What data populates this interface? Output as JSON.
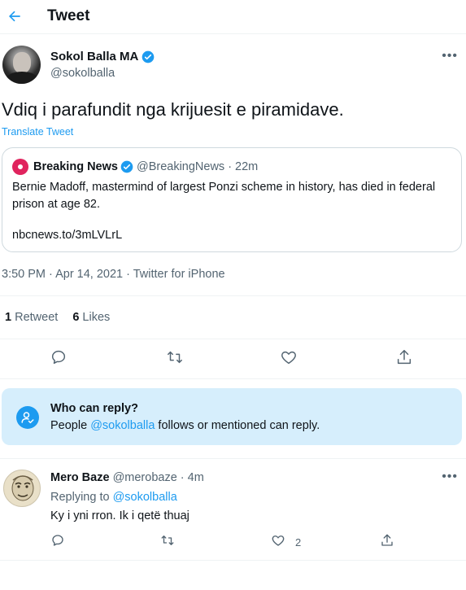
{
  "header": {
    "title": "Tweet",
    "back_icon": "arrow-left-icon"
  },
  "author": {
    "name": "Sokol Balla MA",
    "handle": "@sokolballa",
    "verified": true
  },
  "tweet": {
    "text": "Vdiq i parafundit nga krijuesit e piramidave.",
    "translate_label": "Translate Tweet",
    "meta": "3:50 PM · Apr 14, 2021 · Twitter for iPhone"
  },
  "quote": {
    "name": "Breaking News",
    "handle": "@BreakingNews",
    "time": "· 22m",
    "text": "Bernie Madoff, mastermind of largest Ponzi scheme in history, has died in federal prison at age 82.",
    "link": "nbcnews.to/3mLVLrL"
  },
  "stats": {
    "retweets_count": "1",
    "retweets_label": "Retweet",
    "likes_count": "6",
    "likes_label": "Likes"
  },
  "reply_settings": {
    "title": "Who can reply?",
    "desc_prefix": "People ",
    "desc_mention": "@sokolballa",
    "desc_suffix": " follows or mentioned can reply."
  },
  "comment": {
    "name": "Mero Baze",
    "handle": "@merobaze",
    "time": "· 4m",
    "replying_prefix": "Replying to ",
    "replying_mention": "@sokolballa",
    "text": "Ky i yni rron. Ik i qetë thuaj",
    "like_count": "2"
  },
  "colors": {
    "accent": "#1d9bf0",
    "muted": "#536471",
    "reply_box_bg": "#d6eefc"
  }
}
